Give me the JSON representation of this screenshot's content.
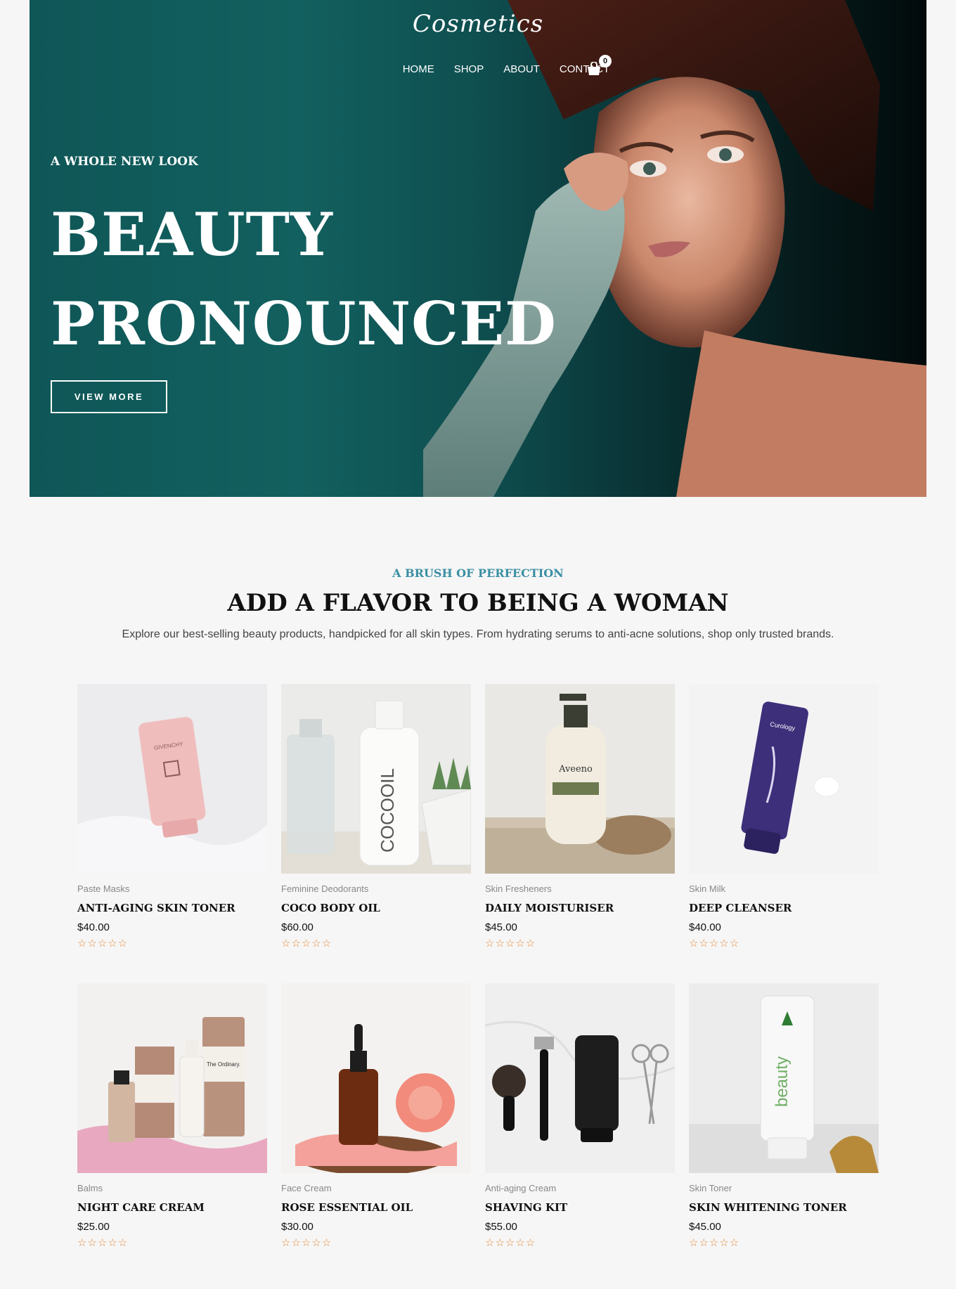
{
  "brand": {
    "logo_text": "Cosmetics"
  },
  "nav": {
    "items": [
      {
        "label": "HOME"
      },
      {
        "label": "SHOP"
      },
      {
        "label": "ABOUT"
      },
      {
        "label": "CONTACT"
      }
    ],
    "cart_count": "0",
    "cart_icon": "shopping-bag-icon"
  },
  "hero": {
    "eyebrow": "A WHOLE NEW LOOK",
    "headline_line1": "BEAUTY",
    "headline_line2": "PRONOUNCED",
    "button_label": "VIEW MORE"
  },
  "section": {
    "eyebrow": "A BRUSH OF PERFECTION",
    "title": "ADD A FLAVOR TO BEING A WOMAN",
    "description": "Explore our best-selling beauty products, handpicked for all skin types. From hydrating serums to anti-acne solutions, shop only trusted brands."
  },
  "colors": {
    "accent": "#3a8fa3",
    "star": "#e58a3b",
    "hero_teal": "#12605f"
  },
  "products": [
    {
      "category": "Paste Masks",
      "name": "ANTI-AGING SKIN TONER",
      "price": "$40.00",
      "rating": 0
    },
    {
      "category": "Feminine Deodorants",
      "name": "COCO BODY OIL",
      "price": "$60.00",
      "rating": 0
    },
    {
      "category": "Skin Fresheners",
      "name": "DAILY MOISTURISER",
      "price": "$45.00",
      "rating": 0
    },
    {
      "category": "Skin Milk",
      "name": "DEEP CLEANSER",
      "price": "$40.00",
      "rating": 0
    },
    {
      "category": "Balms",
      "name": "NIGHT CARE CREAM",
      "price": "$25.00",
      "rating": 0
    },
    {
      "category": "Face Cream",
      "name": "ROSE ESSENTIAL OIL",
      "price": "$30.00",
      "rating": 0
    },
    {
      "category": "Anti-aging Cream",
      "name": "SHAVING KIT",
      "price": "$55.00",
      "rating": 0
    },
    {
      "category": "Skin Toner",
      "name": "SKIN WHITENING TONER",
      "price": "$45.00",
      "rating": 0
    }
  ],
  "stars_text": "☆☆☆☆☆",
  "product_labels": {
    "givenchy": "GIVENCHY",
    "cocooil": "COCOOIL",
    "aveeno": "Aveeno",
    "curology": "Curology",
    "ordinary": "The Ordinary.",
    "beauty": "beauty"
  }
}
